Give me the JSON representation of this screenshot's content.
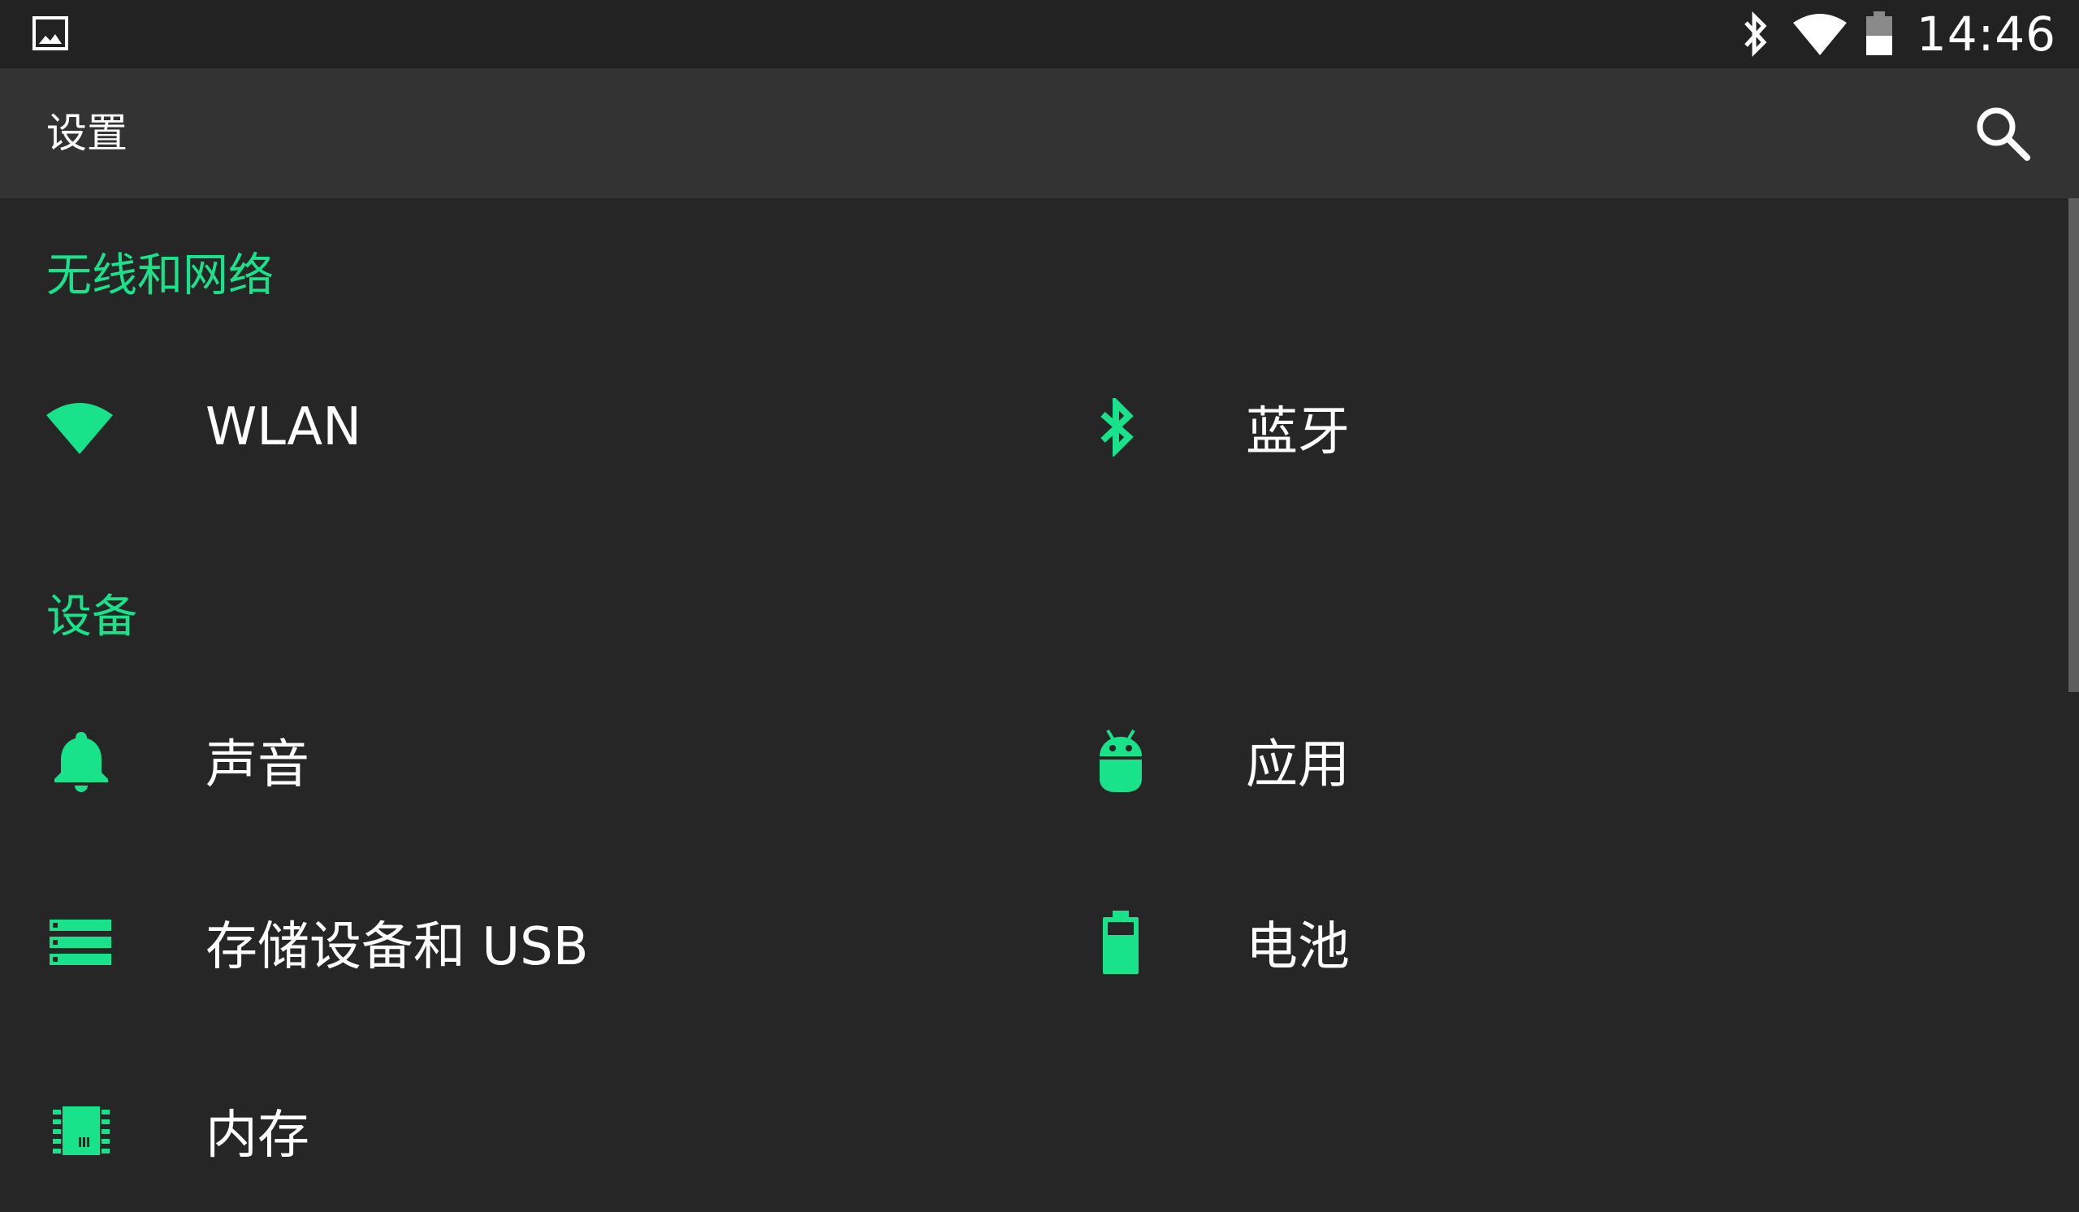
{
  "status_bar": {
    "left_icon": "image-icon",
    "icons": [
      "bluetooth-icon",
      "wifi-icon",
      "battery-icon"
    ],
    "time": "14:46"
  },
  "toolbar": {
    "title": "设置",
    "search_icon": "search-icon"
  },
  "colors": {
    "accent": "#19e38a",
    "background": "#262626",
    "toolbar": "#333333",
    "status_bar": "#222222"
  },
  "sections": [
    {
      "title": "无线和网络",
      "items": [
        {
          "label": "WLAN",
          "icon": "wifi-icon"
        },
        {
          "label": "蓝牙",
          "icon": "bluetooth-icon"
        }
      ]
    },
    {
      "title": "设备",
      "items": [
        {
          "label": "声音",
          "icon": "bell-icon"
        },
        {
          "label": "应用",
          "icon": "android-icon"
        },
        {
          "label": "存储设备和 USB",
          "icon": "storage-icon"
        },
        {
          "label": "电池",
          "icon": "battery-icon"
        },
        {
          "label": "内存",
          "icon": "memory-icon"
        }
      ]
    }
  ]
}
